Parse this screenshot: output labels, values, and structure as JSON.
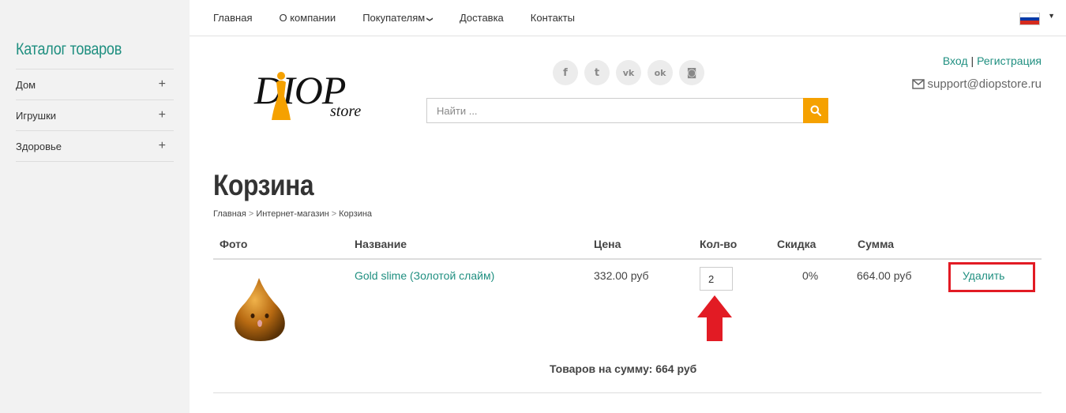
{
  "sidebar": {
    "title": "Каталог товаров",
    "items": [
      {
        "label": "Дом",
        "toggle": "+"
      },
      {
        "label": "Игрушки",
        "toggle": "+"
      },
      {
        "label": "Здоровье",
        "toggle": "+"
      }
    ]
  },
  "topnav": {
    "items": [
      "Главная",
      "О компании",
      "Покупателям",
      "Доставка",
      "Контакты"
    ],
    "dropdown_chevron": "❯",
    "language": {
      "flag": "russia-flag-icon",
      "caret": "▼",
      "colors": [
        "#ffffff",
        "#0039a6",
        "#d52b1e"
      ]
    }
  },
  "logo": {
    "main": "DIOP",
    "sub": "store"
  },
  "social": {
    "icons": [
      "facebook-icon",
      "twitter-icon",
      "vk-icon",
      "odnoklassniki-icon",
      "instagram-icon"
    ],
    "glyphs": [
      "f",
      "t",
      "vk",
      "ok",
      "◙"
    ]
  },
  "search": {
    "placeholder": "Найти ...",
    "button_icon": "search-icon",
    "accent": "#f5a100"
  },
  "auth": {
    "login": "Вход",
    "separator": "|",
    "register": "Регистрация"
  },
  "support": {
    "icon": "envelope-icon",
    "email": "support@diopstore.ru"
  },
  "page": {
    "title": "Корзина",
    "breadcrumb": [
      "Главная",
      "Интернет-магазин",
      "Корзина"
    ],
    "breadcrumb_sep": ">"
  },
  "cart": {
    "columns": {
      "photo": "Фото",
      "name": "Название",
      "price": "Цена",
      "qty": "Кол-во",
      "discount": "Скидка",
      "sum": "Сумма"
    },
    "rows": [
      {
        "name": "Gold slime (Золотой слайм)",
        "price": "332.00 руб",
        "qty": "2",
        "discount": "0%",
        "sum": "664.00 руб",
        "delete": "Удалить"
      }
    ],
    "total": "Товаров на сумму: 664 руб"
  },
  "colors": {
    "accent": "#1f8f80",
    "highlight": "#e21b24",
    "orange": "#f5a100"
  }
}
